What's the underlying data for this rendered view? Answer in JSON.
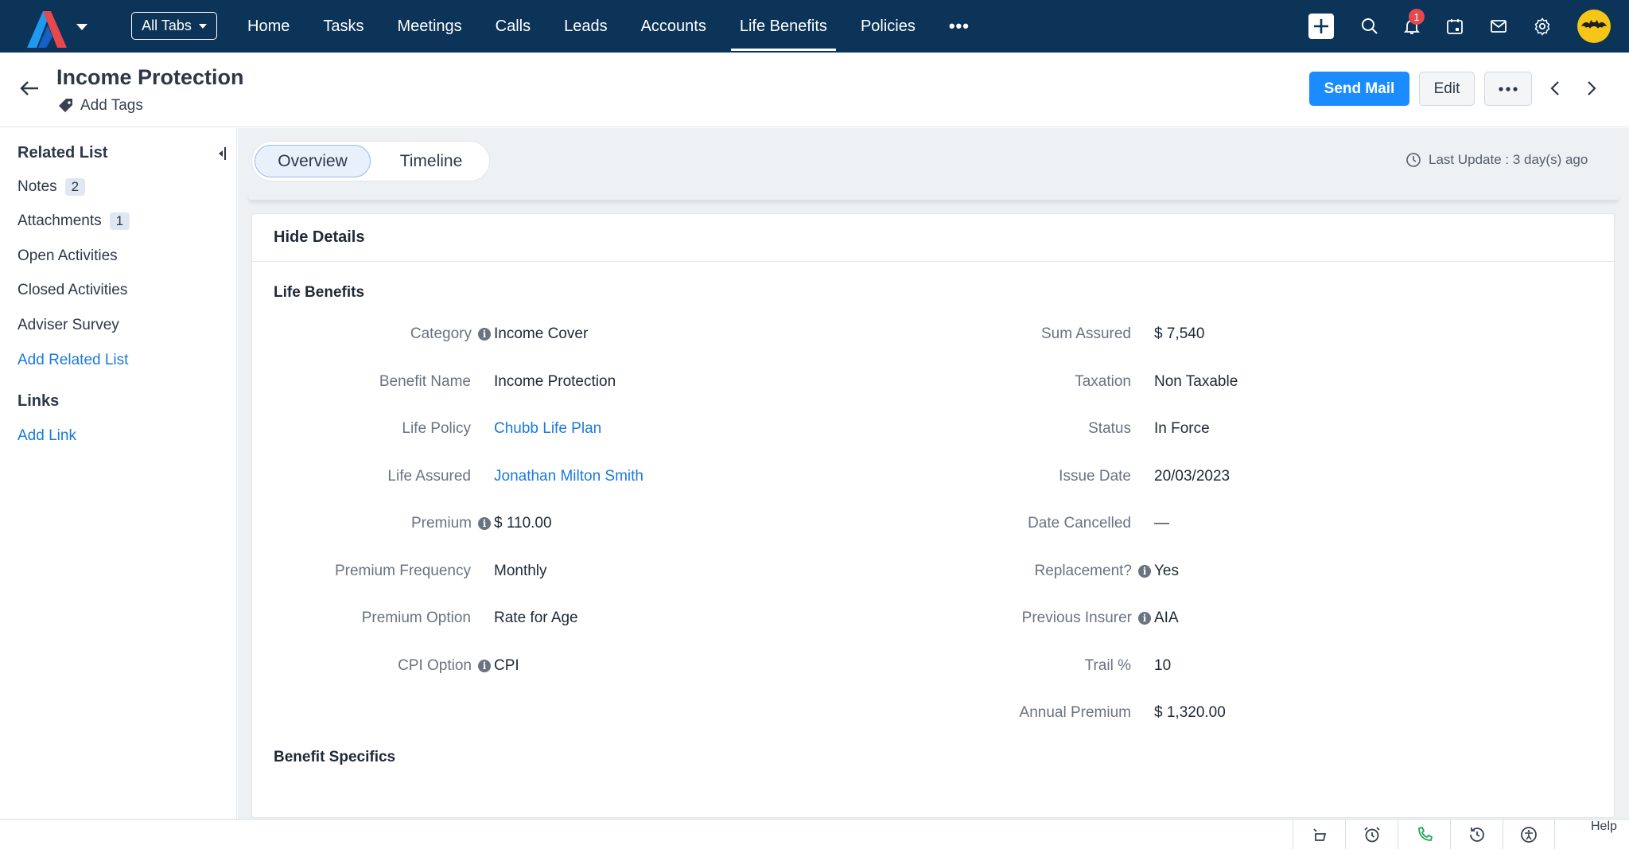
{
  "topnav": {
    "all_tabs_label": "All Tabs",
    "tabs": [
      "Home",
      "Tasks",
      "Meetings",
      "Calls",
      "Leads",
      "Accounts",
      "Life Benefits",
      "Policies"
    ],
    "active_tab": "Life Benefits",
    "more_label": "•••",
    "notification_count": "1",
    "accent_color": "#0c3358"
  },
  "record": {
    "title": "Income Protection",
    "add_tags_label": "Add Tags",
    "send_mail_label": "Send Mail",
    "edit_label": "Edit",
    "more_label": "•••"
  },
  "sidebar": {
    "related_list_heading": "Related List",
    "items": [
      {
        "label": "Notes",
        "count": "2"
      },
      {
        "label": "Attachments",
        "count": "1"
      },
      {
        "label": "Open Activities"
      },
      {
        "label": "Closed Activities"
      },
      {
        "label": "Adviser Survey"
      }
    ],
    "add_related_list_label": "Add Related List",
    "links_heading": "Links",
    "add_link_label": "Add Link"
  },
  "main": {
    "tabs": [
      "Overview",
      "Timeline"
    ],
    "active_tab": "Overview",
    "last_update": "Last Update : 3 day(s) ago",
    "hide_details_label": "Hide Details",
    "section_title": "Life Benefits",
    "next_section_title": "Benefit Specifics",
    "left_fields": [
      {
        "label": "Category",
        "value": "Income Cover",
        "info": true
      },
      {
        "label": "Benefit Name",
        "value": "Income Protection"
      },
      {
        "label": "Life Policy",
        "value": "Chubb Life Plan",
        "link": true
      },
      {
        "label": "Life Assured",
        "value": "Jonathan Milton Smith",
        "link": true
      },
      {
        "label": "Premium",
        "value": "$ 110.00",
        "info": true
      },
      {
        "label": "Premium Frequency",
        "value": "Monthly"
      },
      {
        "label": "Premium Option",
        "value": "Rate for Age"
      },
      {
        "label": "CPI Option",
        "value": "CPI",
        "info": true
      }
    ],
    "right_fields": [
      {
        "label": "Sum Assured",
        "value": "$ 7,540"
      },
      {
        "label": "Taxation",
        "value": "Non Taxable"
      },
      {
        "label": "Status",
        "value": "In Force"
      },
      {
        "label": "Issue Date",
        "value": "20/03/2023"
      },
      {
        "label": "Date Cancelled",
        "value": "—"
      },
      {
        "label": "Replacement?",
        "value": "Yes",
        "info": true
      },
      {
        "label": "Previous Insurer",
        "value": "AIA",
        "info": true
      },
      {
        "label": "Trail %",
        "value": "10"
      },
      {
        "label": "Annual Premium",
        "value": "$ 1,320.00"
      }
    ]
  },
  "bottombar": {
    "help_label": "Help"
  }
}
